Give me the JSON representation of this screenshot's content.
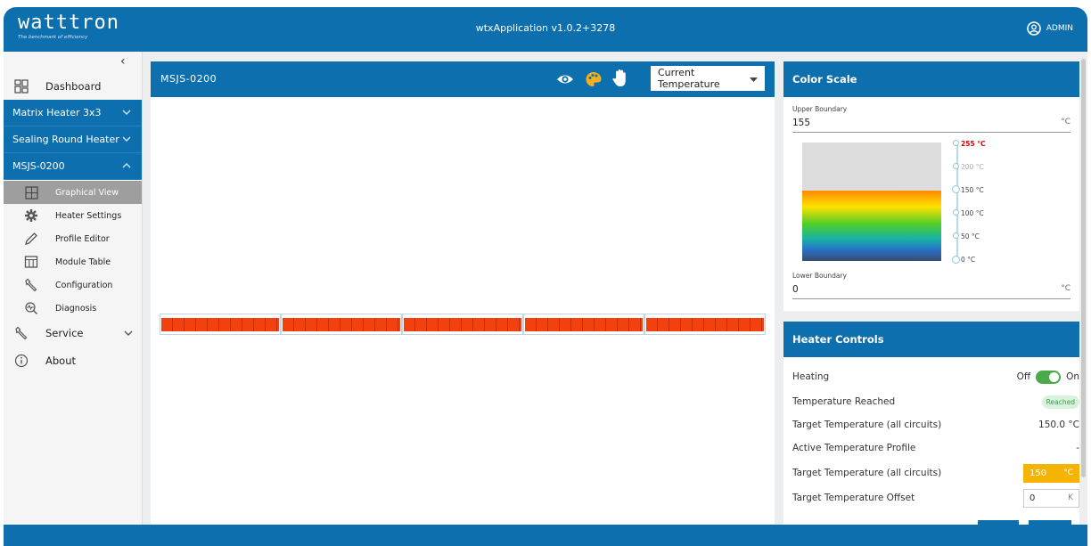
{
  "header": {
    "logo": "watttron",
    "tagline": "The benchmark of efficiency",
    "app_title": "wtxApplication v1.0.2+3278",
    "user_label": "ADMIN"
  },
  "sidebar": {
    "collapse_icon": "chevron-left-icon",
    "dashboard": "Dashboard",
    "groups": [
      {
        "label": "Matrix Heater 3x3",
        "icon": "chevron-down-icon"
      },
      {
        "label": "Sealing Round Heater",
        "icon": "chevron-down-icon"
      },
      {
        "label": "MSJS-0200",
        "icon": "chevron-up-icon"
      }
    ],
    "sub_items": [
      {
        "label": "Graphical View",
        "icon": "graphical-view-icon"
      },
      {
        "label": "Heater Settings",
        "icon": "gear-icon"
      },
      {
        "label": "Profile Editor",
        "icon": "pencil-icon"
      },
      {
        "label": "Module Table",
        "icon": "table-icon"
      },
      {
        "label": "Configuration",
        "icon": "wrench-icon"
      },
      {
        "label": "Diagnosis",
        "icon": "diagnosis-icon"
      }
    ],
    "service": "Service",
    "about": "About"
  },
  "viewer": {
    "title": "MSJS-0200",
    "selected_view": "Current Temperature",
    "modules": 5,
    "colors": {
      "heater": "#f2400e"
    }
  },
  "color_scale": {
    "title": "Color Scale",
    "upper_label": "Upper Boundary",
    "upper_value": "155",
    "lower_label": "Lower Boundary",
    "lower_value": "0",
    "unit": "°C",
    "ticks": [
      "255 °C",
      "200 °C",
      "150 °C",
      "100 °C",
      "50 °C",
      "0 °C"
    ]
  },
  "heater_controls": {
    "title": "Heater Controls",
    "heating_label": "Heating",
    "off": "Off",
    "on": "On",
    "heating_on": true,
    "temp_reached_label": "Temperature Reached",
    "temp_reached_badge": "Reached",
    "target_all_label": "Target Temperature (all circuits)",
    "target_all_value": "150.0 °C",
    "active_profile_label": "Active Temperature Profile",
    "active_profile_value": "-",
    "target_input_label": "Target Temperature (all circuits)",
    "target_input_value": "150",
    "target_input_unit": "°C",
    "offset_label": "Target Temperature Offset",
    "offset_value": "0",
    "offset_unit": "K"
  },
  "colors": {
    "primary": "#0e6fae",
    "accent_warm": "#f5b400",
    "status_ok": "#3a9a4a"
  }
}
